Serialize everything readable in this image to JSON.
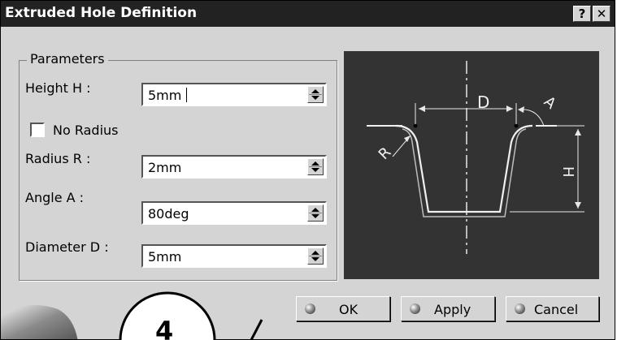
{
  "window": {
    "title": "Extruded Hole Definition",
    "help_label": "?",
    "close_label": "✕"
  },
  "parameters": {
    "group_label": "Parameters",
    "height": {
      "label": "Height H :",
      "value": "5mm"
    },
    "no_radius": {
      "label": "No Radius",
      "checked": false
    },
    "radius": {
      "label": "Radius R :",
      "value": "2mm"
    },
    "angle": {
      "label": "Angle A :",
      "value": "80deg"
    },
    "diameter": {
      "label": "Diameter D :",
      "value": "5mm"
    }
  },
  "preview": {
    "label_d": "D",
    "label_h": "H",
    "label_r": "R",
    "label_a": "A"
  },
  "buttons": {
    "ok": "OK",
    "apply": "Apply",
    "cancel": "Cancel"
  },
  "annotation": {
    "callout_number": "4"
  },
  "colors": {
    "titlebar": "#222222",
    "dialog_bg": "#d4d4d4",
    "preview_bg": "#333333"
  }
}
